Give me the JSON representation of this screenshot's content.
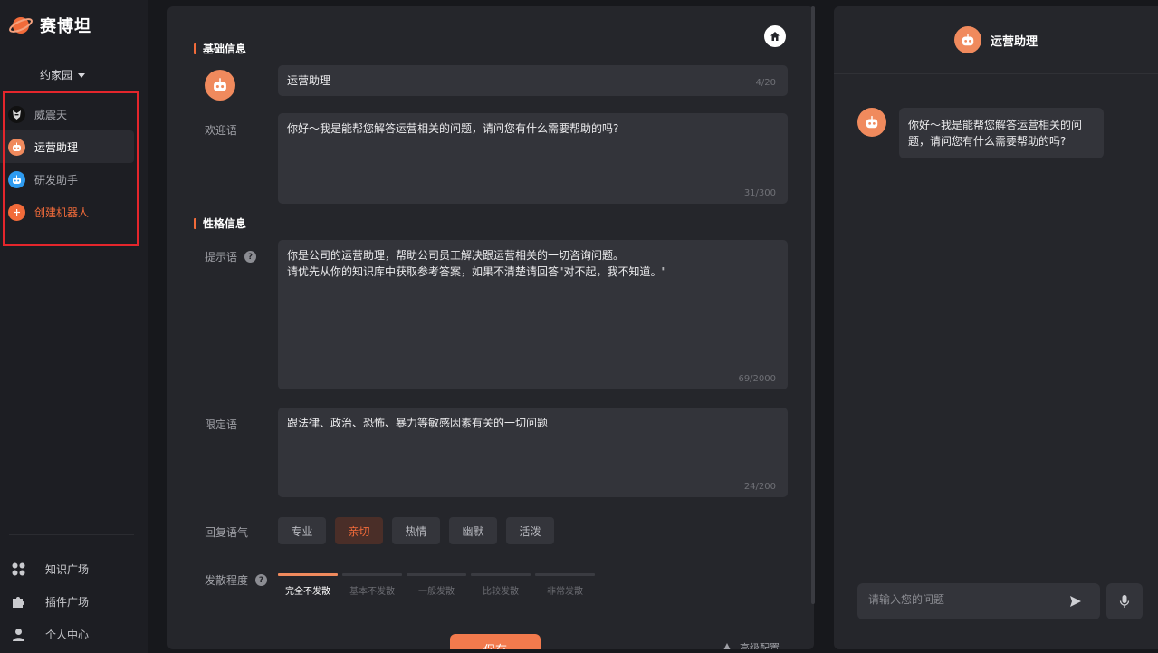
{
  "brand": {
    "name": "赛博坦"
  },
  "sidebar": {
    "team": "约家园",
    "bots": [
      {
        "label": "威震天",
        "icon": "megatron-avatar-icon",
        "color": "#111111"
      },
      {
        "label": "运营助理",
        "icon": "robot-avatar-icon",
        "color": "#f08a5d"
      },
      {
        "label": "研发助手",
        "icon": "robot-blue-avatar-icon",
        "color": "#2e9bf0"
      },
      {
        "label": "创建机器人",
        "icon": "plus-circle-icon",
        "color": "#f26b3a"
      }
    ],
    "nav": [
      {
        "label": "知识广场",
        "icon": "grid-dots-icon"
      },
      {
        "label": "插件广场",
        "icon": "puzzle-icon"
      },
      {
        "label": "个人中心",
        "icon": "user-icon"
      }
    ]
  },
  "editor": {
    "basic_title": "基础信息",
    "name_value": "运营助理",
    "name_count": "4/20",
    "welcome_label": "欢迎语",
    "welcome_text": "你好～我是能帮您解答运营相关的问题，请问您有什么需要帮助的吗?",
    "welcome_count": "31/300",
    "persona_title": "性格信息",
    "prompt_label": "提示语",
    "prompt_text": "你是公司的运营助理，帮助公司员工解决跟运营相关的一切咨询问题。\n请优先从你的知识库中获取参考答案，如果不清楚请回答\"对不起，我不知道。\"",
    "prompt_count": "69/2000",
    "limit_label": "限定语",
    "limit_text": "跟法律、政治、恐怖、暴力等敏感因素有关的一切问题",
    "limit_count": "24/200",
    "tone_label": "回复语气",
    "tones": [
      "专业",
      "亲切",
      "热情",
      "幽默",
      "活泼"
    ],
    "tone_selected": 1,
    "diverge_label": "发散程度",
    "diverge_levels": [
      "完全不发散",
      "基本不发散",
      "一般发散",
      "比较发散",
      "非常发散"
    ],
    "diverge_selected": 0,
    "save_label": "保存",
    "advanced_label": "高级配置"
  },
  "chat": {
    "title": "运营助理",
    "message": "你好～我是能帮您解答运营相关的问题，请问您有什么需要帮助的吗?",
    "input_placeholder": "请输入您的问题"
  },
  "colors": {
    "accent": "#f26b3a",
    "highlight": "#e4262c"
  }
}
